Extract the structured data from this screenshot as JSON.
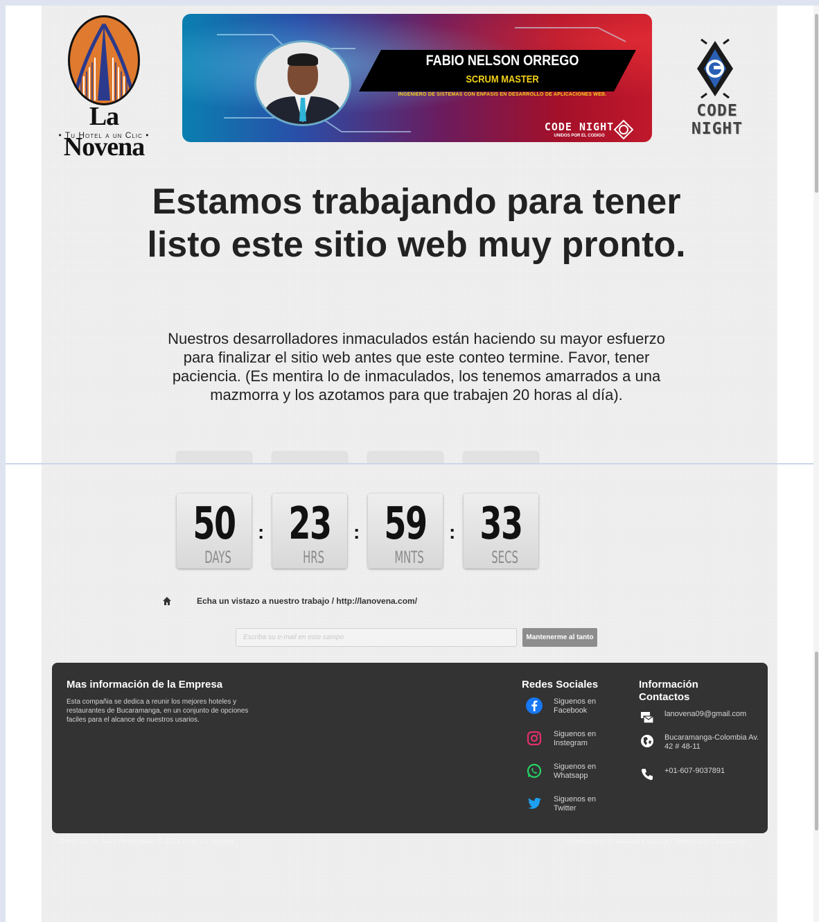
{
  "header": {
    "left_logo": {
      "brand": "La Novena",
      "tagline": "Tu Hotel a un Clic"
    },
    "banner": {
      "name": "FABIO NELSON ORREGO",
      "role": "SCRUM MASTER",
      "description": "INGENIERO DE SISTEMAS CON ENFASIS EN DESARROLLO DE APLICACIONES WEB.",
      "brand": "CODE NIGHT",
      "brand_sub": "UNIDOS POR EL CODIGO"
    },
    "right_logo": {
      "brand": "CODE NIGHT"
    }
  },
  "main": {
    "headline": "Estamos trabajando para tener listo este sitio web muy pronto.",
    "intro": "Nuestros desarrolladores inmaculados están haciendo su mayor esfuerzo para finalizar el sitio web antes que este conteo termine. Favor, tener paciencia. (Es mentira lo de inmaculados, los tenemos amarrados a una mazmorra y los azotamos para que trabajen 20 horas al día).",
    "countdown": [
      {
        "value": "50",
        "label": "DAYS"
      },
      {
        "value": "23",
        "label": "HRS"
      },
      {
        "value": "59",
        "label": "MNTS"
      },
      {
        "value": "33",
        "label": "SECS"
      }
    ],
    "separator": ":",
    "work_link": "Echa un vistazo a nuestro trabajo / http://lanovena.com/",
    "email_placeholder": "Escriba su e-mail en este campo",
    "notify_button": "Mantenerme al tanto"
  },
  "footer": {
    "company_title": "Mas información de la Empresa",
    "company_text": "Esta compañia se dedica a reunir los mejores hoteles y restaurantes de Bucaramanga, en un conjunto de opciones faciles para el alcance de nuestros usarios.",
    "social_title": "Redes Sociales",
    "social": [
      {
        "label": "Siguenos en Facebook",
        "icon": "facebook-icon",
        "color": "#1877f2"
      },
      {
        "label": "Siguenos en Instegram",
        "icon": "instagram-icon",
        "color": "#e1306c"
      },
      {
        "label": "Siguenos en Whatsapp",
        "icon": "whatsapp-icon",
        "color": "#25d366"
      },
      {
        "label": "Siguenos en Twitter",
        "icon": "twitter-icon",
        "color": "#1da1f2"
      }
    ],
    "contact_title": "Información Contactos",
    "contacts": [
      {
        "label": "lanovena09@gmail.com",
        "icon": "mail-icon"
      },
      {
        "label": "Bucaramanga-Colombia Av. 42 # 48-11",
        "icon": "globe-icon"
      },
      {
        "label": "+01-607-9037891",
        "icon": "phone-icon"
      }
    ],
    "copyright": "Derechos de Autor Reservados © 2021 Hotel La Novena",
    "legal": "Información | Privacidad y politica | Terminos y Condiciones"
  },
  "colors": {
    "footer_bg": "#333333",
    "button_bg": "#8d8d8d",
    "page_bg": "#f1f1f1"
  }
}
